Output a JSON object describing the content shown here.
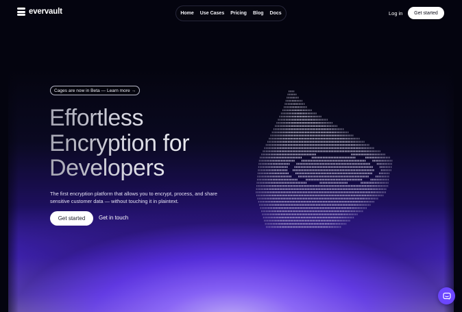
{
  "brand": {
    "name": "evervault"
  },
  "nav": {
    "links": [
      "Home",
      "Use Cases",
      "Pricing",
      "Blog",
      "Docs"
    ],
    "login": "Log in",
    "cta": "Get started"
  },
  "hero": {
    "badge": "Cages are now in Beta — Learn more →",
    "headline": [
      "Effortless",
      "Encryption for",
      "Developers"
    ],
    "subtext": "The first encryption platform that allows you to encrypt, process, and share sensitive customer data — without touching it in plaintext.",
    "primary_cta": "Get started",
    "secondary_cta": "Get in touch"
  },
  "colors": {
    "background": "#04040f",
    "accent_purple": "#6c46ff",
    "glow_light": "#d4c6ff"
  },
  "icons": [
    "evervault-logo-icon",
    "chat-icon"
  ]
}
